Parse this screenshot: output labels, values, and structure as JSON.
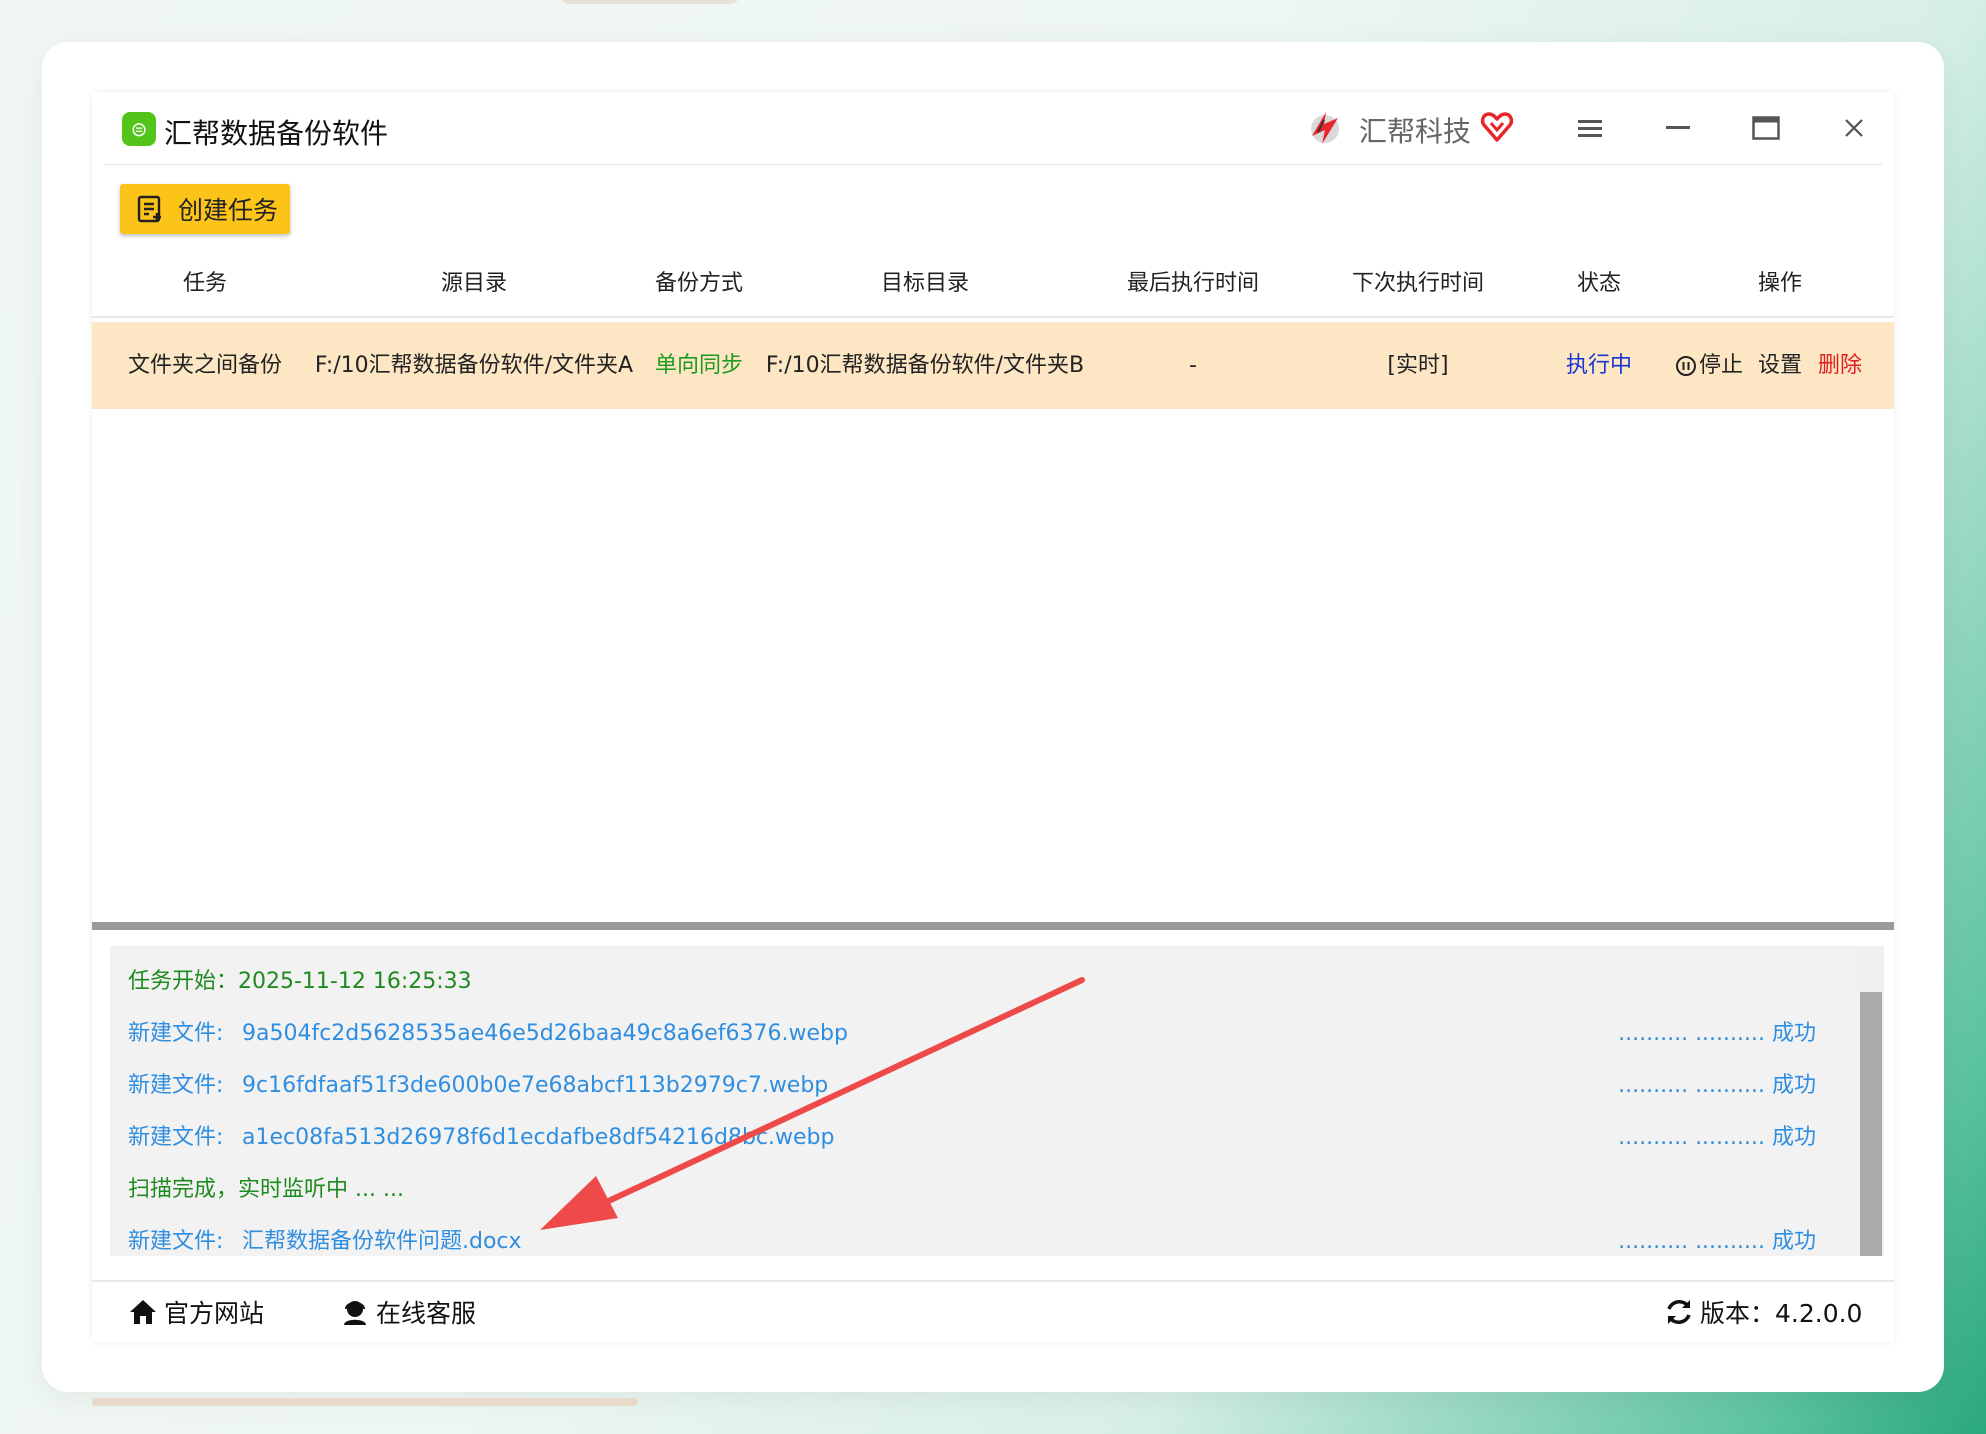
{
  "app": {
    "title": "汇帮数据备份软件",
    "brand_name": "汇帮科技"
  },
  "toolbar": {
    "create_label": "创建任务"
  },
  "table": {
    "headers": [
      "任务",
      "源目录",
      "备份方式",
      "目标目录",
      "最后执行时间",
      "下次执行时间",
      "状态",
      "操作"
    ],
    "rows": [
      {
        "task": "文件夹之间备份",
        "source": "F:/10汇帮数据备份软件/文件夹A",
        "mode": "单向同步",
        "target": "F:/10汇帮数据备份软件/文件夹B",
        "last_run": "-",
        "next_run": "[实时]",
        "status": "执行中",
        "op_stop": "停止",
        "op_settings": "设置",
        "op_delete": "删除"
      }
    ]
  },
  "log": {
    "lines": [
      {
        "text": "任务开始：2025-11-12 16:25:33"
      },
      {
        "label": "新建文件:",
        "file": "9a504fc2d5628535ae46e5d26baa49c8a6ef6376.webp",
        "status": ".......... .......... 成功"
      },
      {
        "label": "新建文件:",
        "file": "9c16fdfaaf51f3de600b0e7e68abcf113b2979c7.webp",
        "status": ".......... .......... 成功"
      },
      {
        "label": "新建文件:",
        "file": "a1ec08fa513d26978f6d1ecdafbe8df54216d8bc.webp",
        "status": ".......... .......... 成功"
      },
      {
        "text": "扫描完成，实时监听中 ... ..."
      },
      {
        "label": "新建文件:",
        "file": "汇帮数据备份软件问题.docx",
        "status": ".......... .......... 成功"
      }
    ]
  },
  "footer": {
    "website": "官方网站",
    "support": "在线客服",
    "version": "版本：4.2.0.0"
  },
  "colors": {
    "accent_yellow": "#fcc419",
    "row_highlight": "#fde6c4",
    "success_green": "#1f8a1f",
    "link_blue": "#2f8ee0",
    "annotation_red": "#ef4a4a"
  }
}
